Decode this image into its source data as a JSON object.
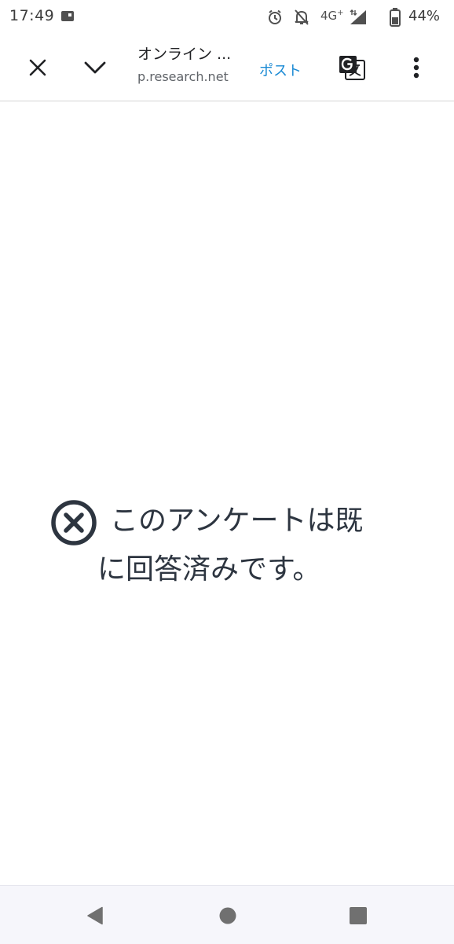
{
  "status_bar": {
    "time": "17:49",
    "network_label": "4G",
    "network_suffix": "+",
    "battery_percent": "44%",
    "icons": [
      "notification-icon",
      "alarm-icon",
      "notifications-off-icon",
      "signal-icon",
      "battery-icon"
    ]
  },
  "toolbar": {
    "close_icon": "close-icon",
    "collapse_icon": "chevron-down-icon",
    "title": "オンライン ...",
    "url": "p.research.net",
    "post_label": "ポスト",
    "translate_icon": "translate-icon",
    "menu_icon": "more-vert-icon"
  },
  "main": {
    "message_icon": "error-circle-icon",
    "message_line1": "このアンケートは既",
    "message_line2": "に回答済みです。"
  },
  "nav_bar": {
    "back_icon": "back-icon",
    "home_icon": "home-icon",
    "recents_icon": "recents-icon"
  },
  "colors": {
    "accent": "#1a8ad4",
    "text_dark": "#2d3540",
    "nav_bg": "#f6f6fb"
  }
}
